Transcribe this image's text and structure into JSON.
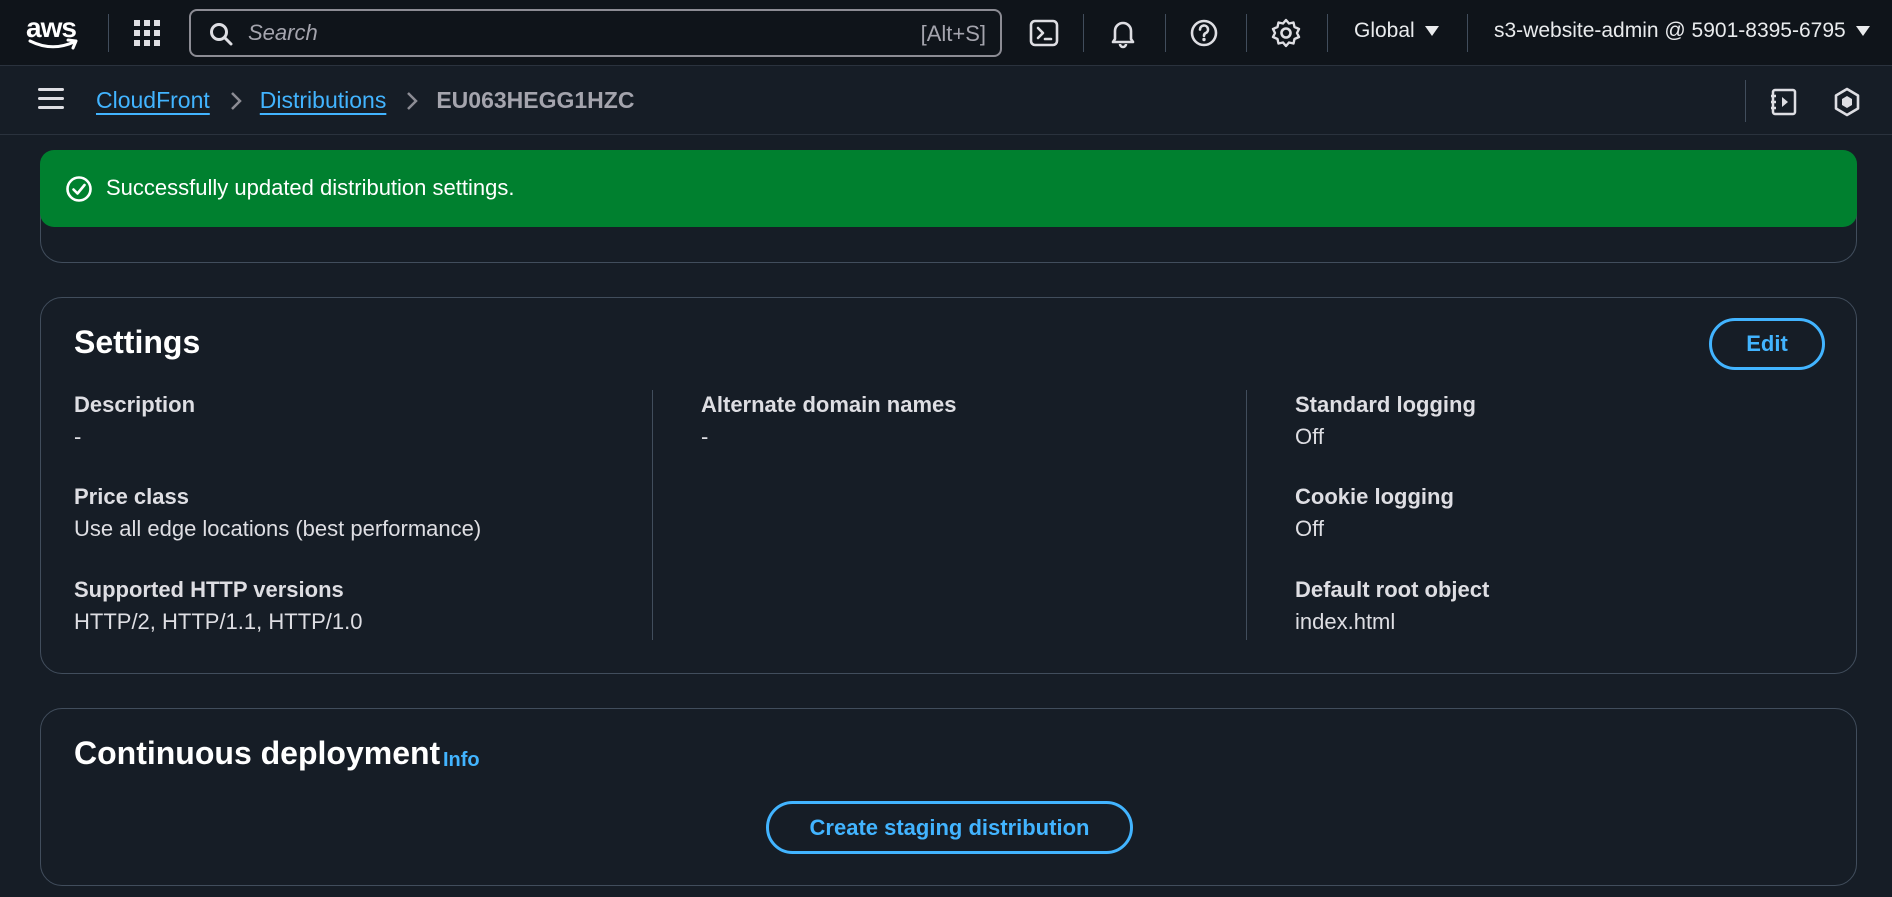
{
  "topnav": {
    "logo_text": "aws",
    "search_placeholder": "Search",
    "search_shortcut": "[Alt+S]",
    "region": "Global",
    "account": "s3-website-admin @ 5901-8395-6795"
  },
  "breadcrumb": {
    "items": [
      "CloudFront",
      "Distributions"
    ],
    "current": "EU063HEGG1HZC"
  },
  "flash": {
    "message": "Successfully updated distribution settings.",
    "color": "#00802f"
  },
  "settings": {
    "title": "Settings",
    "edit_label": "Edit",
    "fields": {
      "description": {
        "label": "Description",
        "value": "-"
      },
      "price_class": {
        "label": "Price class",
        "value": "Use all edge locations (best performance)"
      },
      "http_versions": {
        "label": "Supported HTTP versions",
        "value": "HTTP/2, HTTP/1.1, HTTP/1.0"
      },
      "alt_domains": {
        "label": "Alternate domain names",
        "value": "-"
      },
      "standard_logging": {
        "label": "Standard logging",
        "value": "Off"
      },
      "cookie_logging": {
        "label": "Cookie logging",
        "value": "Off"
      },
      "default_root": {
        "label": "Default root object",
        "value": "index.html"
      }
    }
  },
  "continuous_deployment": {
    "title": "Continuous deployment",
    "info_label": "Info",
    "button_label": "Create staging distribution"
  },
  "colors": {
    "accent": "#42b4ff",
    "background": "#161d26",
    "topbar": "#0f141a"
  },
  "icons": {
    "topnav": [
      "grid-icon",
      "search-icon",
      "cloudshell-icon",
      "bell-icon",
      "help-icon",
      "gear-icon"
    ],
    "flash": "check-circle-icon",
    "tools": [
      "notes-icon",
      "settings-hex-icon"
    ]
  }
}
